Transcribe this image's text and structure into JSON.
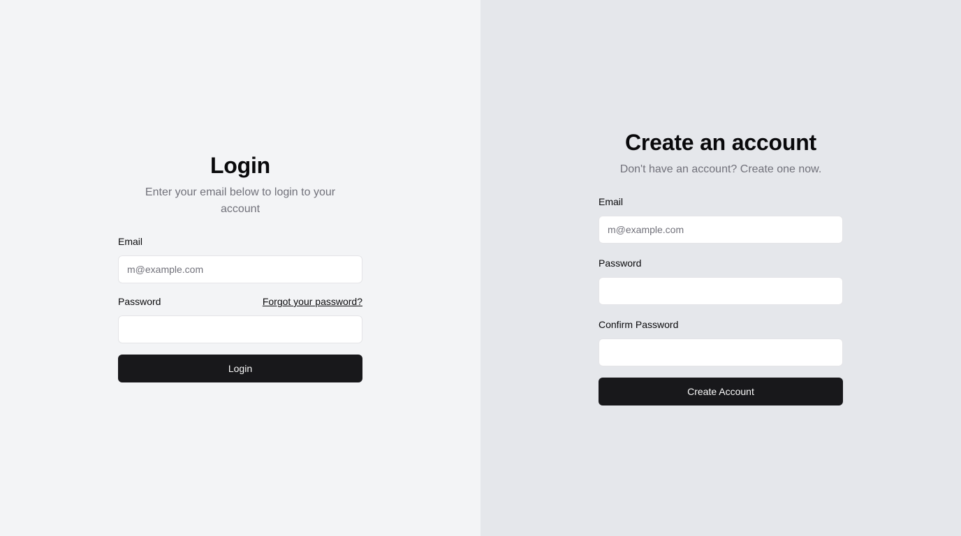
{
  "login": {
    "title": "Login",
    "subtitle": "Enter your email below to login to your account",
    "email_label": "Email",
    "email_placeholder": "m@example.com",
    "email_value": "",
    "password_label": "Password",
    "forgot_link": "Forgot your password?",
    "password_value": "",
    "submit_label": "Login"
  },
  "signup": {
    "title": "Create an account",
    "subtitle": "Don't have an account? Create one now.",
    "email_label": "Email",
    "email_placeholder": "m@example.com",
    "email_value": "",
    "password_label": "Password",
    "password_value": "",
    "confirm_label": "Confirm Password",
    "confirm_value": "",
    "submit_label": "Create Account"
  },
  "colors": {
    "left_bg": "#f3f4f6",
    "right_bg": "#e5e7eb",
    "button_bg": "#18181b",
    "muted_text": "#71717a"
  }
}
